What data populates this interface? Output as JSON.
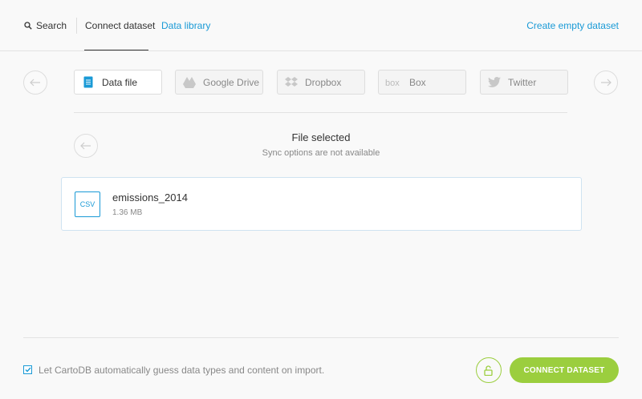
{
  "nav": {
    "search_label": "Search",
    "tab_connect": "Connect dataset",
    "tab_library": "Data library",
    "create_empty": "Create empty dataset"
  },
  "sources": [
    {
      "label": "Data file",
      "icon": "document-icon",
      "active": true
    },
    {
      "label": "Google Drive",
      "icon": "google-drive-icon",
      "active": false
    },
    {
      "label": "Dropbox",
      "icon": "dropbox-icon",
      "active": false
    },
    {
      "label": "Box",
      "icon": "box-icon",
      "active": false
    },
    {
      "label": "Twitter",
      "icon": "twitter-icon",
      "active": false
    }
  ],
  "selection": {
    "title": "File selected",
    "subtitle": "Sync options are not available"
  },
  "file": {
    "type": "CSV",
    "name": "emissions_2014",
    "size": "1.36 MB"
  },
  "footer": {
    "checkbox_label": "Let CartoDB automatically guess data types and content on import.",
    "checkbox_checked": true,
    "connect_label": "CONNECT DATASET"
  },
  "colors": {
    "accent_blue": "#1a9ad6",
    "accent_green": "#9bce3e"
  }
}
